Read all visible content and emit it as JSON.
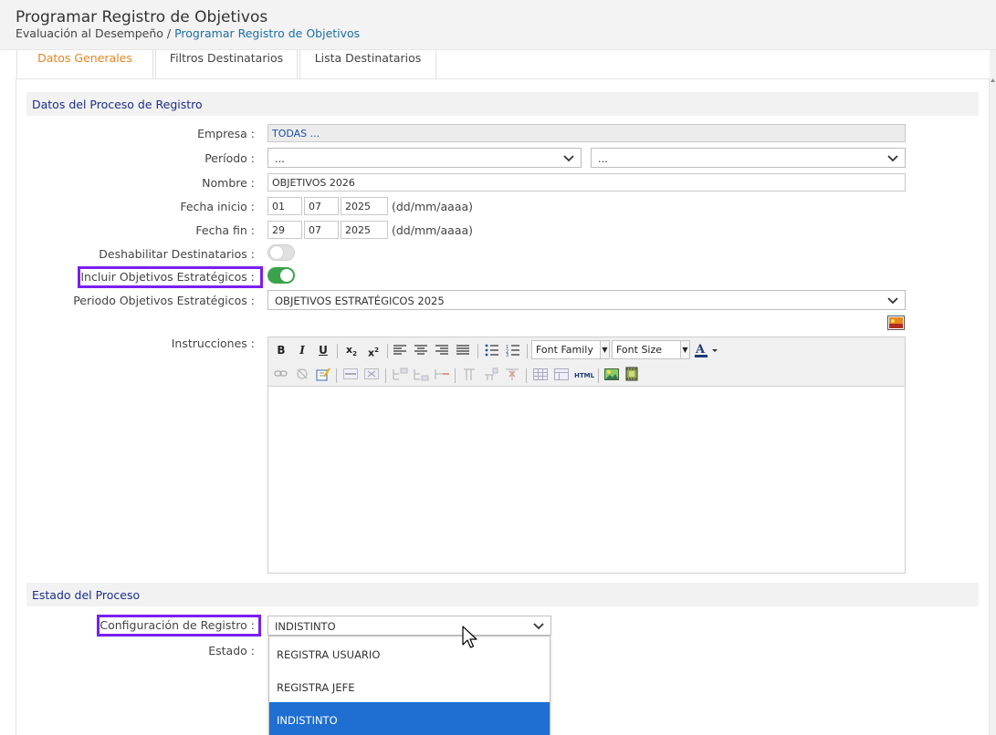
{
  "header": {
    "title": "Programar Registro de Objetivos",
    "breadcrumb_parent": "Evaluación al Desempeño",
    "breadcrumb_sep": "/",
    "breadcrumb_current": "Programar Registro de Objetivos"
  },
  "tabs": [
    {
      "label": "Datos Generales",
      "active": true
    },
    {
      "label": "Filtros Destinatarios",
      "active": false
    },
    {
      "label": "Lista Destinatarios",
      "active": false
    }
  ],
  "section1": {
    "title": "Datos del Proceso de Registro",
    "empresa_label": "Empresa :",
    "empresa_value": "TODAS ...",
    "periodo_label": "Período :",
    "periodo_value1": "...",
    "periodo_value2": "...",
    "nombre_label": "Nombre :",
    "nombre_value": "OBJETIVOS 2026",
    "fecha_inicio_label": "Fecha inicio :",
    "fecha_inicio": {
      "dd": "01",
      "mm": "07",
      "aaaa": "2025"
    },
    "fecha_fin_label": "Fecha fin :",
    "fecha_fin": {
      "dd": "29",
      "mm": "07",
      "aaaa": "2025"
    },
    "date_hint": "(dd/mm/aaaa)",
    "deshabilitar_label": "Deshabilitar Destinatarios :",
    "deshabilitar_on": false,
    "incluir_label": "Incluir Objetivos Estratégicos :",
    "incluir_on": true,
    "periodo_obj_label": "Periodo Objetivos Estratégicos :",
    "periodo_obj_value": "OBJETIVOS ESTRATÉGICOS 2025",
    "instrucciones_label": "Instrucciones :"
  },
  "editor_toolbar": {
    "font_family": "Font Family",
    "font_size": "Font Size",
    "html_label": "HTML"
  },
  "section2": {
    "title": "Estado del Proceso",
    "config_label": "Configuración de Registro :",
    "config_value": "INDISTINTO",
    "estado_label": "Estado :",
    "options": [
      "REGISTRA USUARIO",
      "REGISTRA JEFE",
      "INDISTINTO"
    ],
    "selected_option": "INDISTINTO"
  },
  "colors": {
    "accent_tab": "#e6851e",
    "section_title": "#1b2d8a",
    "highlight": "#7a1ff0",
    "toggle_on": "#3aa34a",
    "dropdown_selected": "#1e6fd1"
  }
}
